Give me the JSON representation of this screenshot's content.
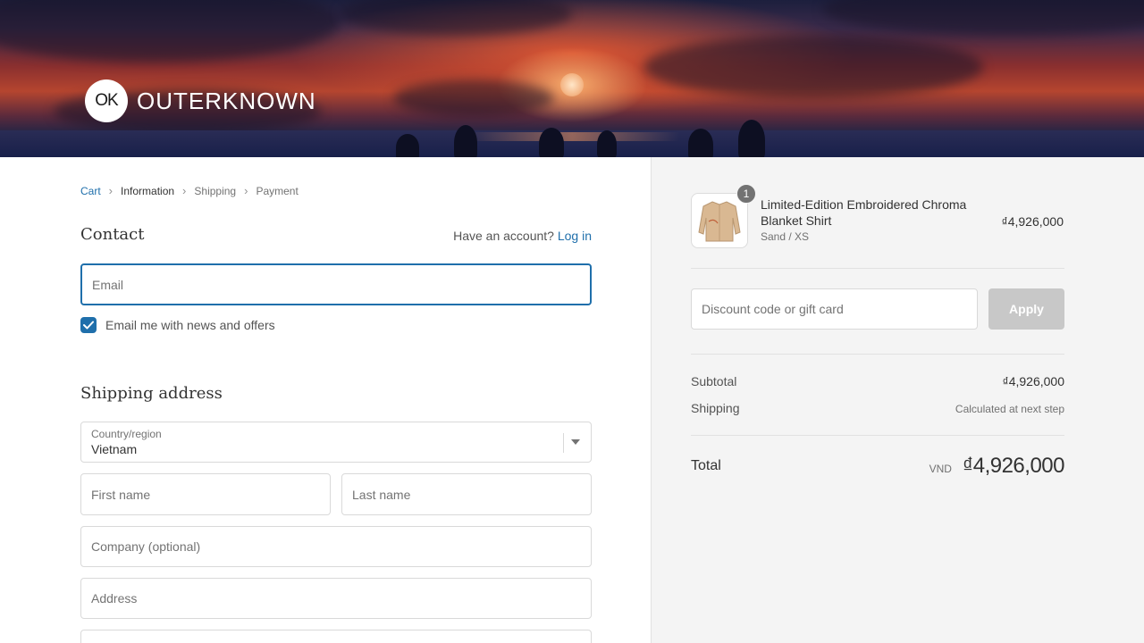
{
  "brand": {
    "badge": "OK",
    "name": "OUTERKNOWN"
  },
  "breadcrumb": {
    "items": [
      "Cart",
      "Information",
      "Shipping",
      "Payment"
    ]
  },
  "contact": {
    "title": "Contact",
    "account_prompt": "Have an account?",
    "login_label": "Log in",
    "email_placeholder": "Email",
    "newsletter_label": "Email me with news and offers",
    "newsletter_checked": true
  },
  "shipping": {
    "title": "Shipping address",
    "country_label": "Country/region",
    "country_value": "Vietnam",
    "first_name_placeholder": "First name",
    "last_name_placeholder": "Last name",
    "company_placeholder": "Company (optional)",
    "address_placeholder": "Address"
  },
  "order": {
    "item": {
      "quantity": "1",
      "name": "Limited-Edition Embroidered Chroma Blanket Shirt",
      "variant": "Sand / XS",
      "price": "₫4,926,000"
    },
    "discount_placeholder": "Discount code or gift card",
    "apply_label": "Apply",
    "subtotal_label": "Subtotal",
    "subtotal_value": "₫4,926,000",
    "shipping_label": "Shipping",
    "shipping_value": "Calculated at next step",
    "total_label": "Total",
    "currency": "VND",
    "total_value": "₫4,926,000"
  },
  "colors": {
    "accent": "#1f6fab",
    "sidebar_bg": "#f4f4f4",
    "apply_disabled": "#c8c8c8"
  }
}
